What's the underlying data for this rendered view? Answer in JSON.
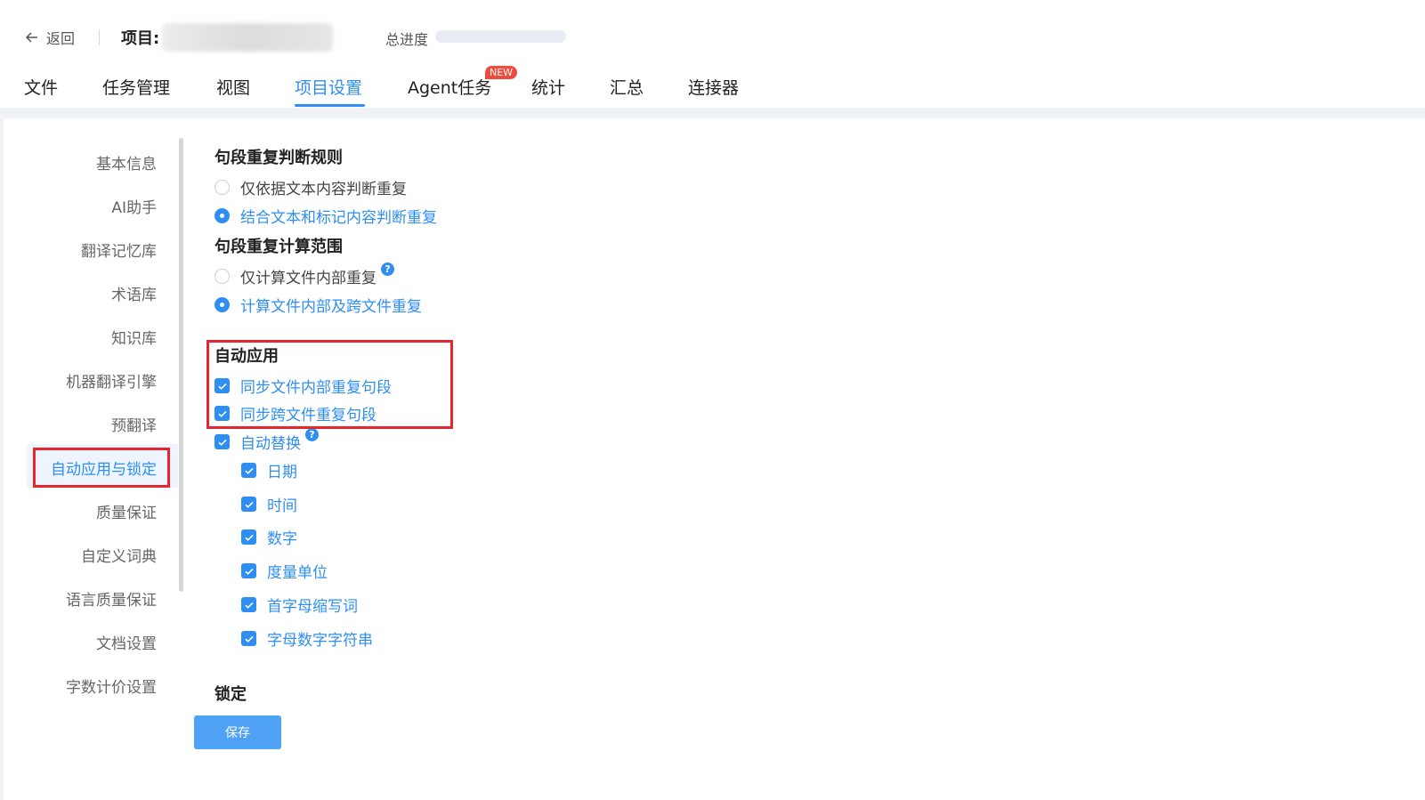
{
  "header": {
    "back_label": "返回",
    "project_label": "项目:",
    "progress_label": "总进度",
    "progress_value": 0,
    "accent_color": "#2f8ef2"
  },
  "tabs": [
    {
      "label": "文件"
    },
    {
      "label": "任务管理"
    },
    {
      "label": "视图"
    },
    {
      "label": "项目设置",
      "active": true
    },
    {
      "label": "Agent任务",
      "badge": "NEW"
    },
    {
      "label": "统计"
    },
    {
      "label": "汇总"
    },
    {
      "label": "连接器"
    }
  ],
  "sidebar": {
    "items": [
      {
        "label": "基本信息"
      },
      {
        "label": "AI助手"
      },
      {
        "label": "翻译记忆库"
      },
      {
        "label": "术语库"
      },
      {
        "label": "知识库"
      },
      {
        "label": "机器翻译引擎"
      },
      {
        "label": "预翻译"
      },
      {
        "label": "自动应用与锁定",
        "active": true
      },
      {
        "label": "质量保证"
      },
      {
        "label": "自定义词典"
      },
      {
        "label": "语言质量保证"
      },
      {
        "label": "文档设置"
      },
      {
        "label": "字数计价设置"
      }
    ]
  },
  "main": {
    "dup_rule": {
      "title": "句段重复判断规则",
      "options": [
        {
          "label": "仅依据文本内容判断重复",
          "selected": false
        },
        {
          "label": "结合文本和标记内容判断重复",
          "selected": true
        }
      ]
    },
    "dup_scope": {
      "title": "句段重复计算范围",
      "options": [
        {
          "label": "仅计算文件内部重复",
          "selected": false,
          "help_icon": "?"
        },
        {
          "label": "计算文件内部及跨文件重复",
          "selected": true
        }
      ]
    },
    "auto_apply": {
      "title": "自动应用",
      "options": [
        {
          "label": "同步文件内部重复句段",
          "checked": true
        },
        {
          "label": "同步跨文件重复句段",
          "checked": true
        },
        {
          "label": "自动替换",
          "checked": true,
          "help_icon": "?"
        }
      ],
      "sub_options": [
        {
          "label": "日期",
          "checked": true
        },
        {
          "label": "时间",
          "checked": true
        },
        {
          "label": "数字",
          "checked": true
        },
        {
          "label": "度量单位",
          "checked": true
        },
        {
          "label": "首字母缩写词",
          "checked": true
        },
        {
          "label": "字母数字字符串",
          "checked": true
        }
      ]
    },
    "lock": {
      "title": "锁定"
    },
    "save_label": "保存"
  }
}
